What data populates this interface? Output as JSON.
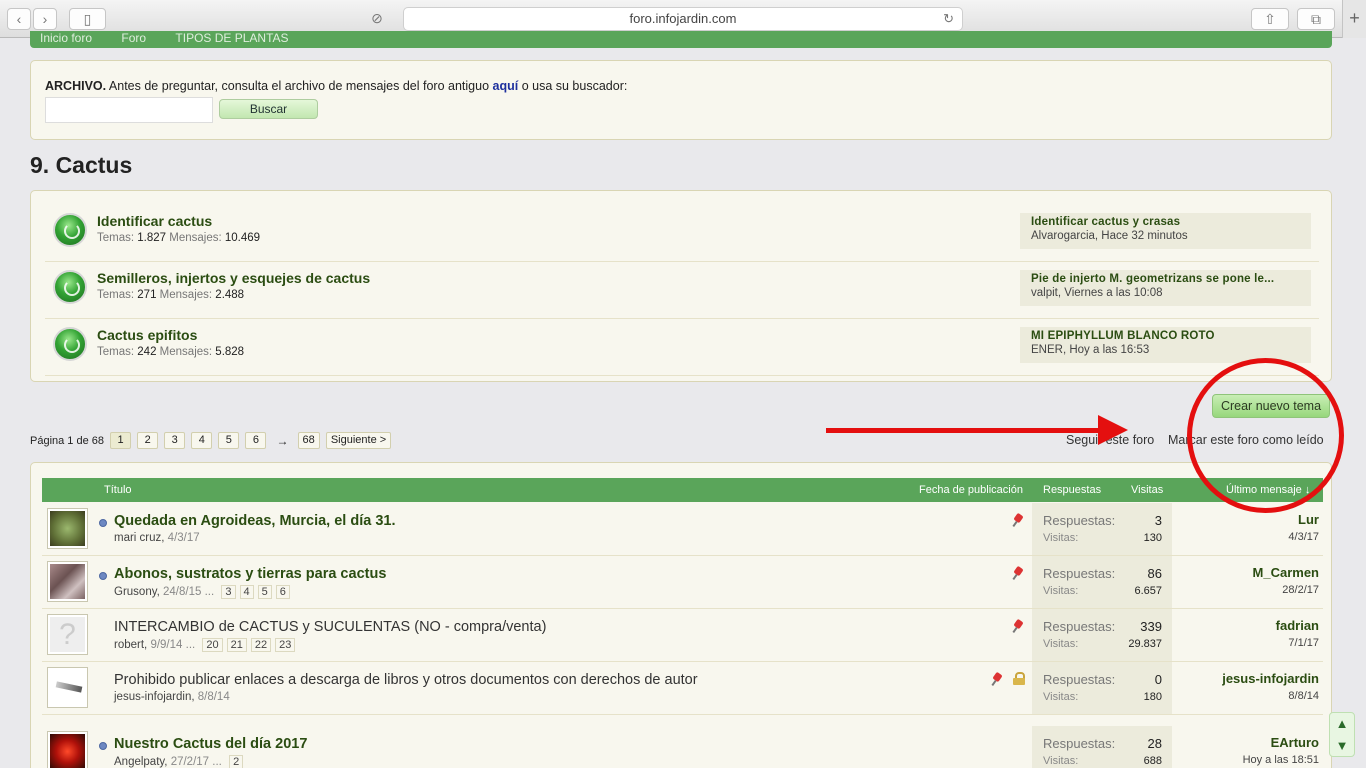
{
  "browser": {
    "url": "foro.infojardin.com",
    "back_icon": "chevron-left-icon",
    "forward_icon": "chevron-right-icon",
    "sidebar_icon": "sidebar-icon",
    "reader_icon": "block-icon",
    "reload_icon": "reload-icon",
    "share_icon": "share-icon",
    "tabs_icon": "tabs-icon",
    "new_tab": "+"
  },
  "breadcrumb": {
    "items": [
      "Inicio foro",
      "Foro",
      "TIPOS DE PLANTAS"
    ]
  },
  "archive": {
    "label": "ARCHIVO.",
    "text_before": "Antes de preguntar, consulta el archivo de mensajes del foro antiguo",
    "link": "aquí",
    "text_after": "o usa su buscador:",
    "search_value": "",
    "button": "Buscar"
  },
  "forum": {
    "title": "9. Cactus"
  },
  "subforums": [
    {
      "name": "Identificar cactus",
      "temas_label": "Temas:",
      "temas": "1.827",
      "mensajes_label": "Mensajes:",
      "mensajes": "10.469",
      "last_title": "Identificar cactus y crasas",
      "last_meta": "Alvarogarcia, Hace 32 minutos"
    },
    {
      "name": "Semilleros, injertos y esquejes de cactus",
      "temas_label": "Temas:",
      "temas": "271",
      "mensajes_label": "Mensajes:",
      "mensajes": "2.488",
      "last_title": "Pie de injerto M. geometrizans se pone le...",
      "last_meta": "valpit, Viernes a las 10:08"
    },
    {
      "name": "Cactus epifitos",
      "temas_label": "Temas:",
      "temas": "242",
      "mensajes_label": "Mensajes:",
      "mensajes": "5.828",
      "last_title": "MI EPIPHYLLUM BLANCO ROTO",
      "last_meta": "ENER, Hoy a las 16:53"
    }
  ],
  "actions": {
    "create": "Crear nuevo tema",
    "follow": "Seguir este foro",
    "mark_read": "Marcar este foro como leído"
  },
  "pagination": {
    "label": "Página 1 de 68",
    "pages": [
      "1",
      "2",
      "3",
      "4",
      "5",
      "6"
    ],
    "arrow": "→",
    "last": "68",
    "next": "Siguiente >"
  },
  "table_header": {
    "title": "Título",
    "date": "Fecha de publicación",
    "replies": "Respuestas",
    "views": "Visitas",
    "last": "Último mensaje ↓"
  },
  "threads": [
    {
      "title": "Quedada en Agroideas, Murcia, el día 31.",
      "author": "mari cruz",
      "date": "4/3/17",
      "pages": [],
      "replies_label": "Respuestas:",
      "replies": "3",
      "views_label": "Visitas:",
      "views": "130",
      "last_user": "Lur",
      "last_date": "4/3/17"
    },
    {
      "title": "Abonos, sustratos y tierras para cactus",
      "author": "Grusony",
      "date": "24/8/15",
      "ellipsis": "...",
      "pages": [
        "3",
        "4",
        "5",
        "6"
      ],
      "replies_label": "Respuestas:",
      "replies": "86",
      "views_label": "Visitas:",
      "views": "6.657",
      "last_user": "M_Carmen",
      "last_date": "28/2/17"
    },
    {
      "title": "INTERCAMBIO de CACTUS y SUCULENTAS (NO - compra/venta)",
      "author": "robert",
      "date": "9/9/14",
      "ellipsis": "...",
      "pages": [
        "20",
        "21",
        "22",
        "23"
      ],
      "replies_label": "Respuestas:",
      "replies": "339",
      "views_label": "Visitas:",
      "views": "29.837",
      "last_user": "fadrian",
      "last_date": "7/1/17"
    },
    {
      "title": "Prohibido publicar enlaces a descarga de libros y otros documentos con derechos de autor",
      "author": "jesus-infojardin",
      "date": "8/8/14",
      "pages": [],
      "replies_label": "Respuestas:",
      "replies": "0",
      "views_label": "Visitas:",
      "views": "180",
      "last_user": "jesus-infojardin",
      "last_date": "8/8/14"
    },
    {
      "title": "Nuestro Cactus del día 2017",
      "author": "Angelpaty",
      "date": "27/2/17",
      "ellipsis": "...",
      "pages": [
        "2"
      ],
      "replies_label": "Respuestas:",
      "replies": "28",
      "views_label": "Visitas:",
      "views": "688",
      "last_user": "EArturo",
      "last_date": "Hoy a las 18:51"
    }
  ],
  "scroll": {
    "up": "▲",
    "down": "▼"
  },
  "colors": {
    "accent_green": "#5aa55a",
    "annotation_red": "#e40f0f"
  }
}
